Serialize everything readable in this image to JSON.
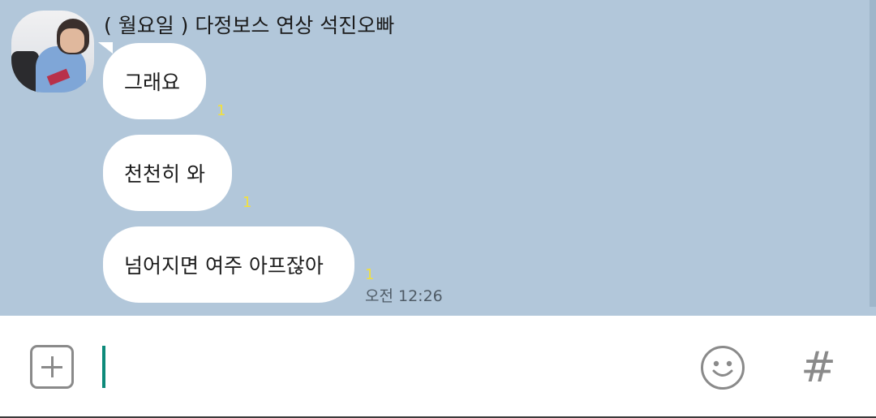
{
  "chat": {
    "sender_name": "( 월요일 ) 다정보스 연상 석진오빠",
    "messages": [
      {
        "text": "그래요",
        "unread": "1"
      },
      {
        "text": "천천히 와",
        "unread": "1"
      },
      {
        "text": "넘어지면 여주 아프잖아",
        "unread": "1",
        "time": "오전 12:26"
      }
    ]
  },
  "input_bar": {
    "attach_icon": "plus-square-icon",
    "emoji_icon": "smiley-face-icon",
    "hashtag_label": "#"
  },
  "colors": {
    "chat_background": "#b2c7da",
    "bubble": "#ffffff",
    "unread_count": "#f2e03c",
    "caret": "#0d8a7a",
    "icon_gray": "#8a8a8a"
  }
}
